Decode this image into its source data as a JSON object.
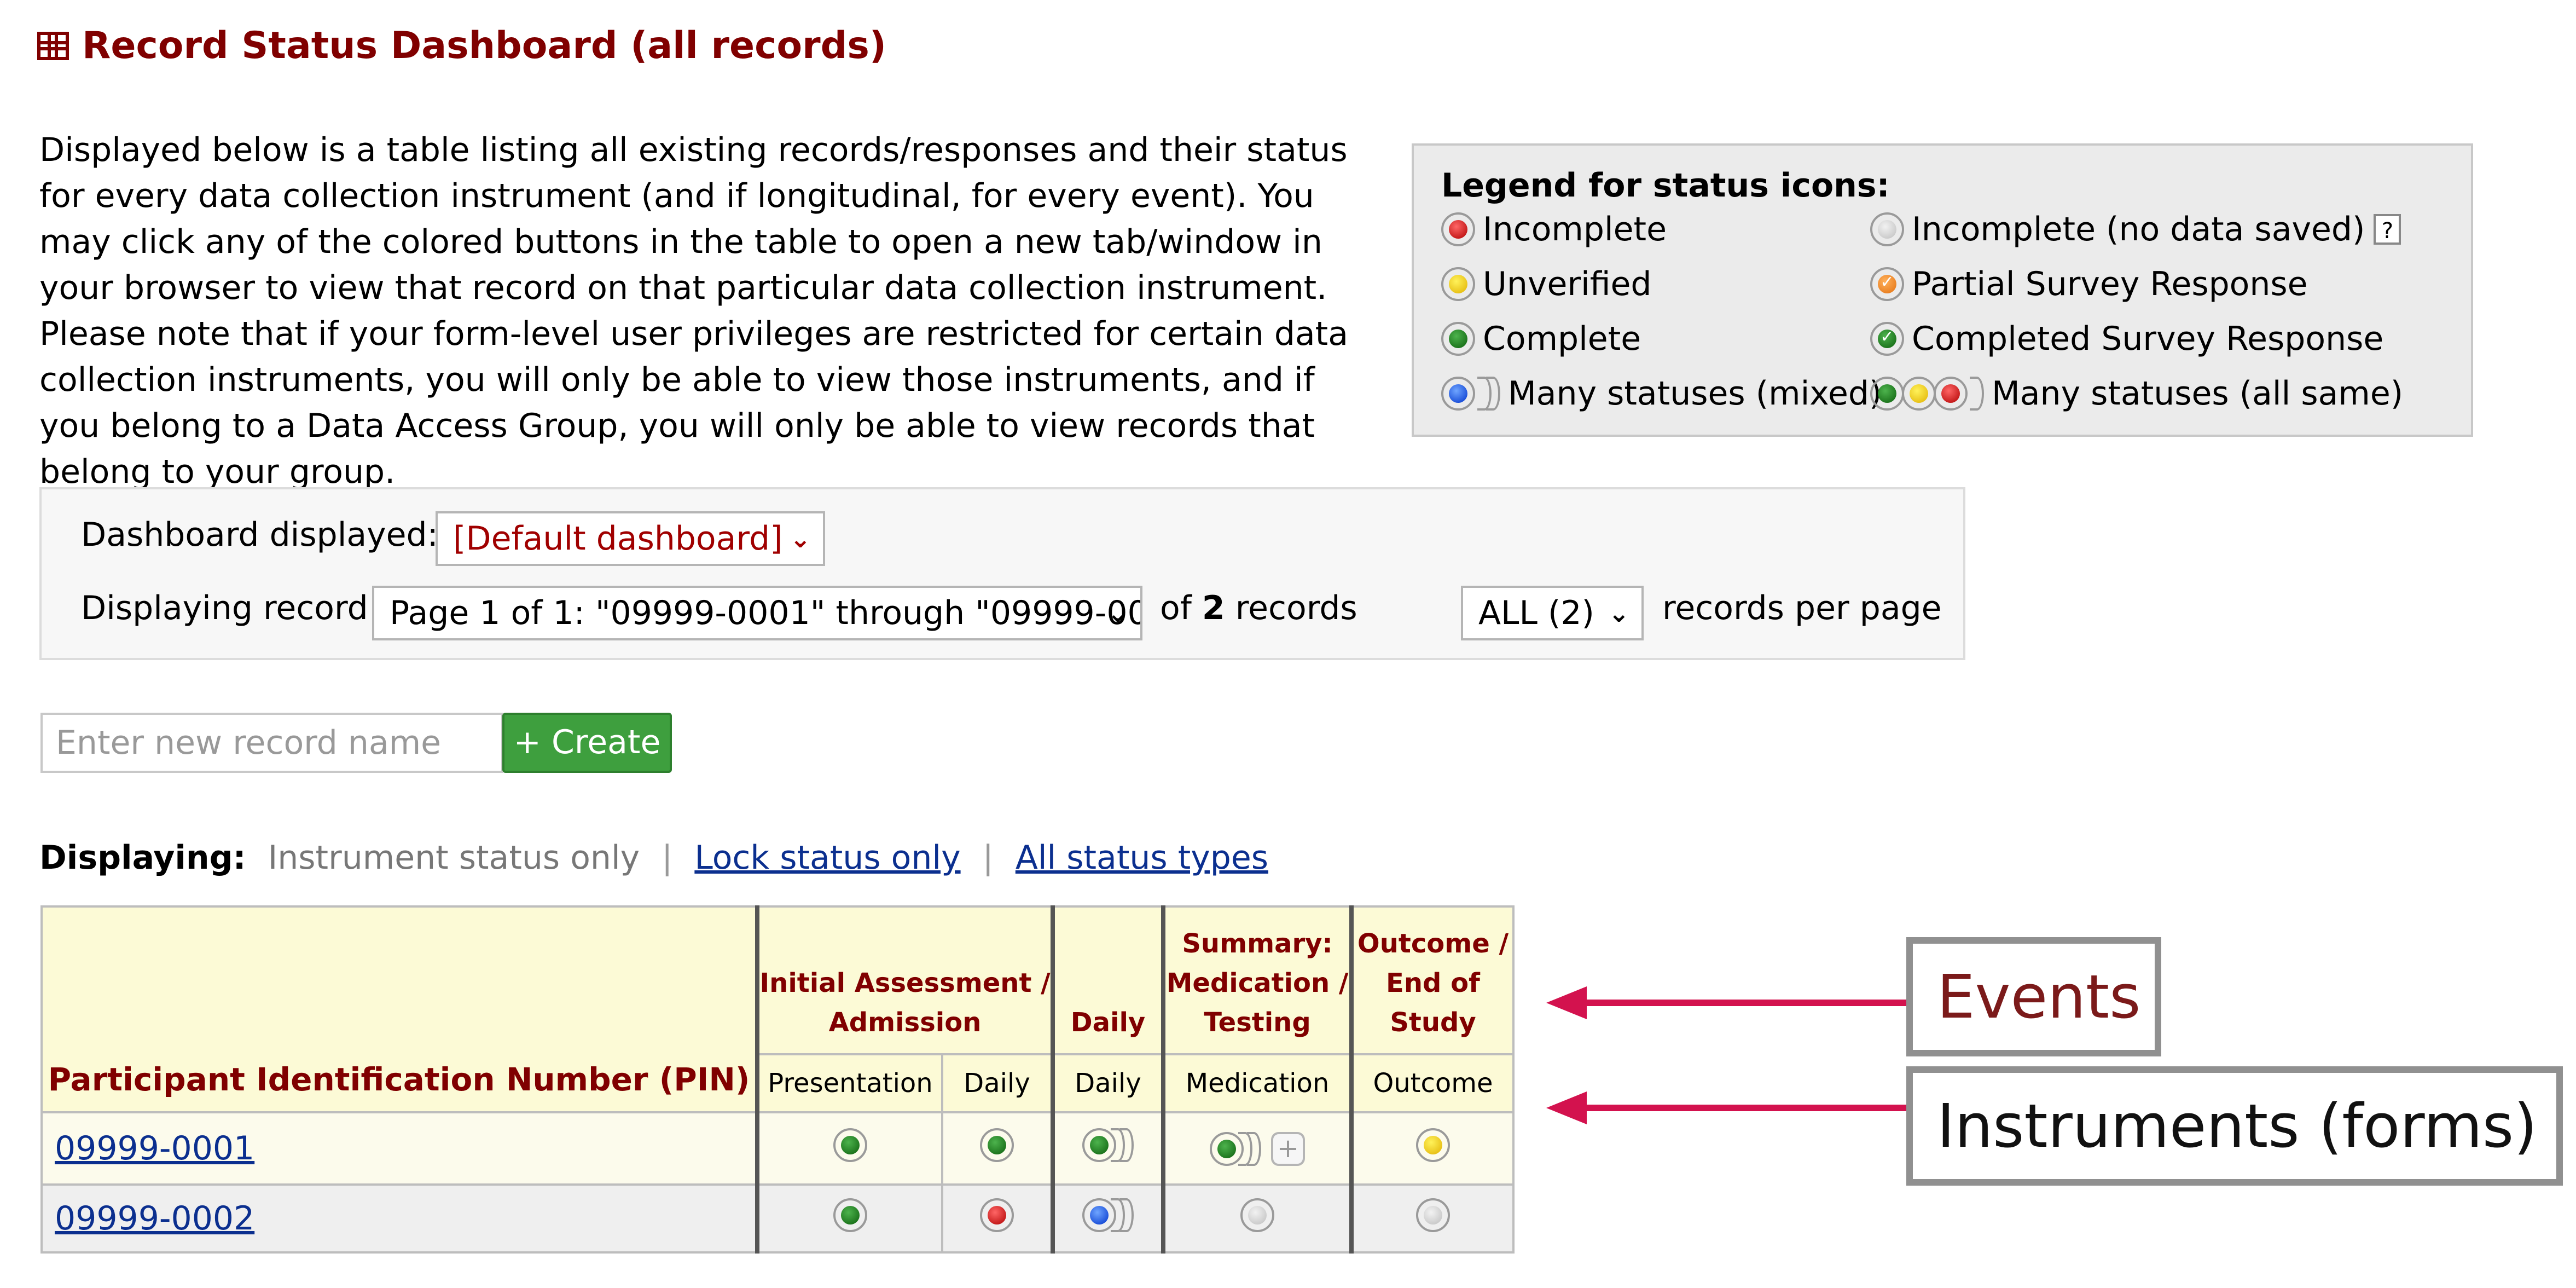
{
  "header": {
    "title": "Record Status Dashboard (all records)"
  },
  "description": "Displayed below is a table listing all existing records/responses and their status for every data collection instrument (and if longitudinal, for every event). You may click any of the colored buttons in the table to open a new tab/window in your browser to view that record on that particular data collection instrument. Please note that if your form-level user privileges are restricted for certain data collection instruments, you will only be able to view those instruments, and if you belong to a Data Access Group, you will only be able to view records that belong to your group.",
  "legend": {
    "title": "Legend for status icons:",
    "incomplete": "Incomplete",
    "unverified": "Unverified",
    "complete": "Complete",
    "many_mixed": "Many statuses (mixed)",
    "incomplete_no_data": "Incomplete (no data saved)",
    "help": "?",
    "partial_survey": "Partial Survey Response",
    "completed_survey": "Completed Survey Response",
    "many_same": "Many statuses (all same)"
  },
  "controls": {
    "dashboard_label": "Dashboard displayed:",
    "dashboard_value": "[Default dashboard]",
    "record_label": "Displaying record",
    "record_range": "Page 1 of 1: \"09999-0001\" through \"09999-00",
    "of_text": "of",
    "record_count": "2",
    "records_text": "records",
    "per_page_value": "ALL (2)",
    "per_page_label": "records per page"
  },
  "new_record": {
    "placeholder": "Enter new record name",
    "create_label": "+ Create"
  },
  "display_filter": {
    "label": "Displaying:",
    "instrument_only": "Instrument status only",
    "separator": "|",
    "lock_only": "Lock status only",
    "all_types": "All status types"
  },
  "table": {
    "pin_header": "Participant Identification Number (PIN)",
    "events": [
      "Initial Assessment / Admission",
      "Daily",
      "Summary: Medication / Testing",
      "Outcome / End of Study"
    ],
    "instruments": [
      "Presentation",
      "Daily",
      "Daily",
      "Medication",
      "Outcome"
    ],
    "rows": [
      {
        "id": "09999-0001",
        "statuses": [
          "complete",
          "complete",
          "many-complete",
          "many-complete+add",
          "unverified"
        ]
      },
      {
        "id": "09999-0002",
        "statuses": [
          "complete",
          "incomplete",
          "many-mixed",
          "no-data",
          "no-data"
        ]
      }
    ]
  },
  "annotations": {
    "events": "Events",
    "instruments": "Instruments (forms)"
  },
  "colors": {
    "maroon": "#800000",
    "link": "#0b2f8f",
    "create_green": "#3e9f3e",
    "arrow": "#d3124e",
    "header_bg": "#fcfad6"
  }
}
